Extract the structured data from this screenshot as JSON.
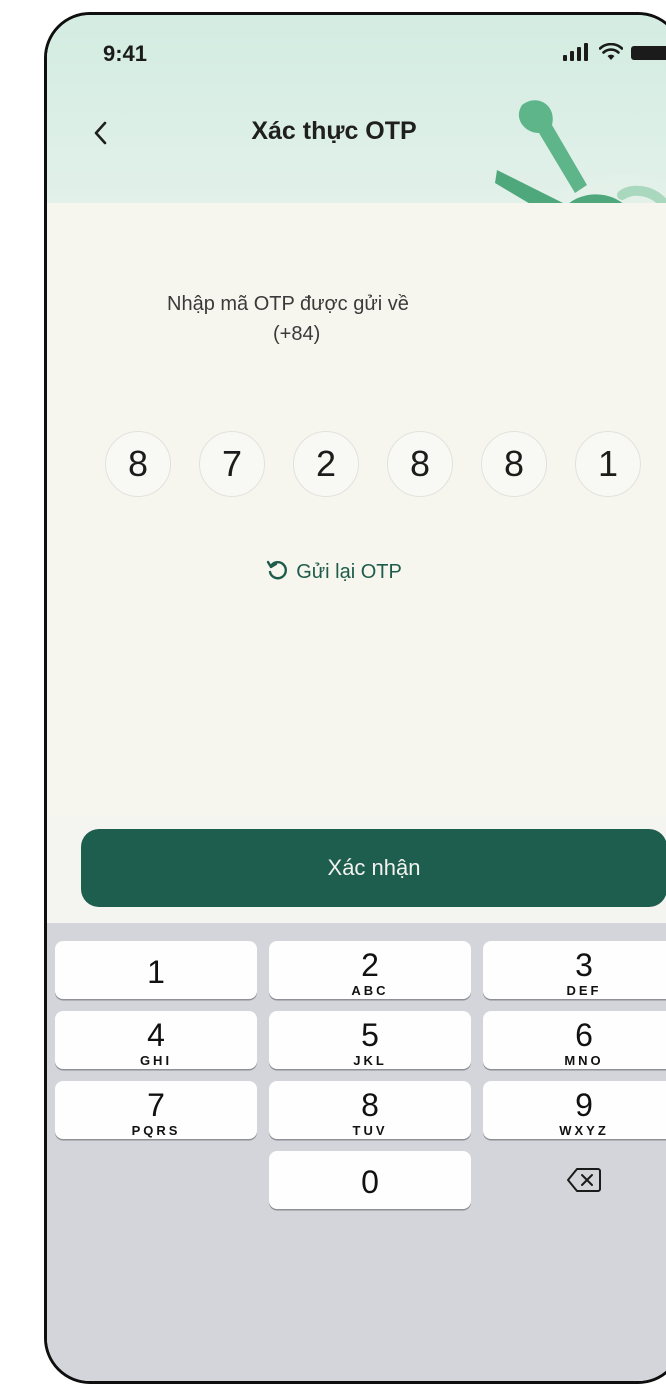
{
  "status_bar": {
    "time": "9:41"
  },
  "header": {
    "title": "Xác thực OTP",
    "back_symbol": "<"
  },
  "instruction": {
    "line1": "Nhập mã OTP được gửi về",
    "line2": "(+84)"
  },
  "otp_digits": [
    "8",
    "7",
    "2",
    "8",
    "8",
    "1"
  ],
  "resend": {
    "label": "Gửi lại OTP"
  },
  "confirm": {
    "label": "Xác nhận"
  },
  "keypad": [
    {
      "num": "1",
      "letters": ""
    },
    {
      "num": "2",
      "letters": "ABC"
    },
    {
      "num": "3",
      "letters": "DEF"
    },
    {
      "num": "4",
      "letters": "GHI"
    },
    {
      "num": "5",
      "letters": "JKL"
    },
    {
      "num": "6",
      "letters": "MNO"
    },
    {
      "num": "7",
      "letters": "PQRS"
    },
    {
      "num": "8",
      "letters": "TUV"
    },
    {
      "num": "9",
      "letters": "WXYZ"
    },
    {
      "num": "0",
      "letters": ""
    }
  ],
  "colors": {
    "primary": "#1e5e4e",
    "header_bg": "#d3ece1",
    "keyboard_bg": "#d4d5da"
  }
}
